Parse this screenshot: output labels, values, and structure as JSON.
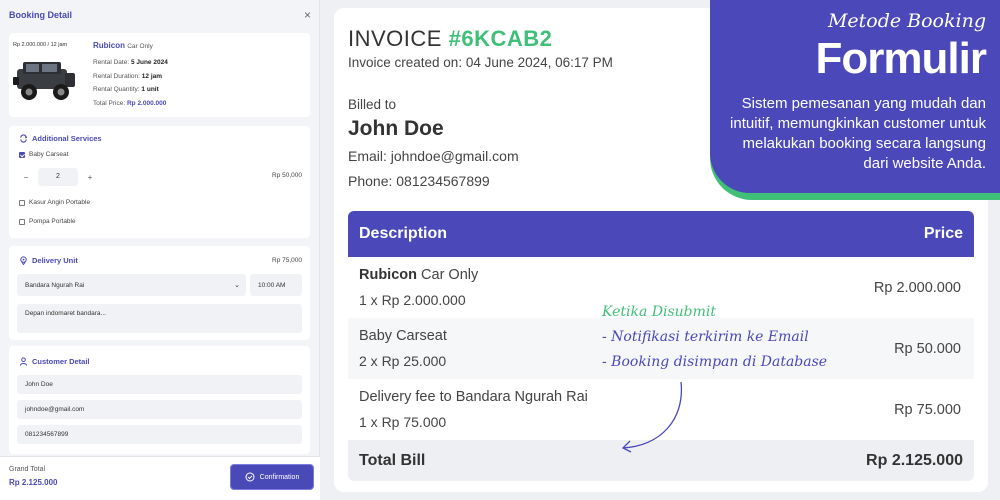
{
  "booking": {
    "title": "Booking Detail",
    "close_icon": "×",
    "car": {
      "price_label": "Rp 2.000.000 / 12 jam",
      "name": "Rubicon",
      "variant": "Car Only",
      "rental_date_label": "Rental Date:",
      "rental_date": "5 June 2024",
      "rental_duration_label": "Rental Duration:",
      "rental_duration": "12 jam",
      "rental_quantity_label": "Rental Quantity:",
      "rental_quantity": "1 unit",
      "total_price_label": "Total Price:",
      "total_price": "Rp 2.000.000"
    },
    "additional_services": {
      "title": "Additional Services",
      "items": [
        {
          "label": "Baby Carseat",
          "checked": true
        },
        {
          "label": "Kasur Angin Portable",
          "checked": false
        },
        {
          "label": "Pompa Portable",
          "checked": false
        }
      ],
      "qty_minus": "−",
      "qty_value": "2",
      "qty_plus": "+",
      "price": "Rp 50,000"
    },
    "delivery": {
      "title": "Delivery Unit",
      "price": "Rp 75,000",
      "location": "Bandara Ngurah Rai",
      "time": "10:00 AM",
      "address_placeholder": "Depan indomaret bandara..."
    },
    "customer": {
      "title": "Customer Detail",
      "name": "John Doe",
      "email": "johndoe@gmail.com",
      "phone": "081234567899"
    },
    "footer": {
      "grand_total_label": "Grand Total",
      "grand_total": "Rp 2.125.000",
      "confirm_label": "Confirmation"
    }
  },
  "invoice": {
    "title_prefix": "INVOICE",
    "code": "#6KCAB2",
    "created": "Invoice created on: 04 June 2024, 06:17 PM",
    "billed_to_label": "Billed to",
    "name": "John Doe",
    "email": "Email: johndoe@gmail.com",
    "phone": "Phone: 081234567899",
    "table": {
      "col_description": "Description",
      "col_price": "Price",
      "rows": [
        {
          "title_bold": "Rubicon",
          "title_rest": " Car Only",
          "detail": "1 x Rp 2.000.000",
          "price": "Rp 2.000.000"
        },
        {
          "title_bold": "",
          "title_rest": "Baby Carseat",
          "detail": "2 x Rp 25.000",
          "price": "Rp 50.000"
        },
        {
          "title_bold": "",
          "title_rest": "Delivery fee to Bandara Ngurah Rai",
          "detail": "1 x Rp 75.000",
          "price": "Rp 75.000"
        }
      ],
      "total_label": "Total Bill",
      "total_value": "Rp 2.125.000"
    }
  },
  "annotation": {
    "heading": "Ketika Disubmit",
    "line1": "- Notifikasi terkirim ke Email",
    "line2": "- Booking disimpan di Database"
  },
  "promo": {
    "subtitle": "Metode Booking",
    "title": "Formulir",
    "description": "Sistem pemesanan yang mudah dan intuitif, memungkinkan customer untuk melakukan booking secara langsung dari website Anda."
  },
  "colors": {
    "accent": "#4b48b9",
    "green": "#3fbf78"
  }
}
